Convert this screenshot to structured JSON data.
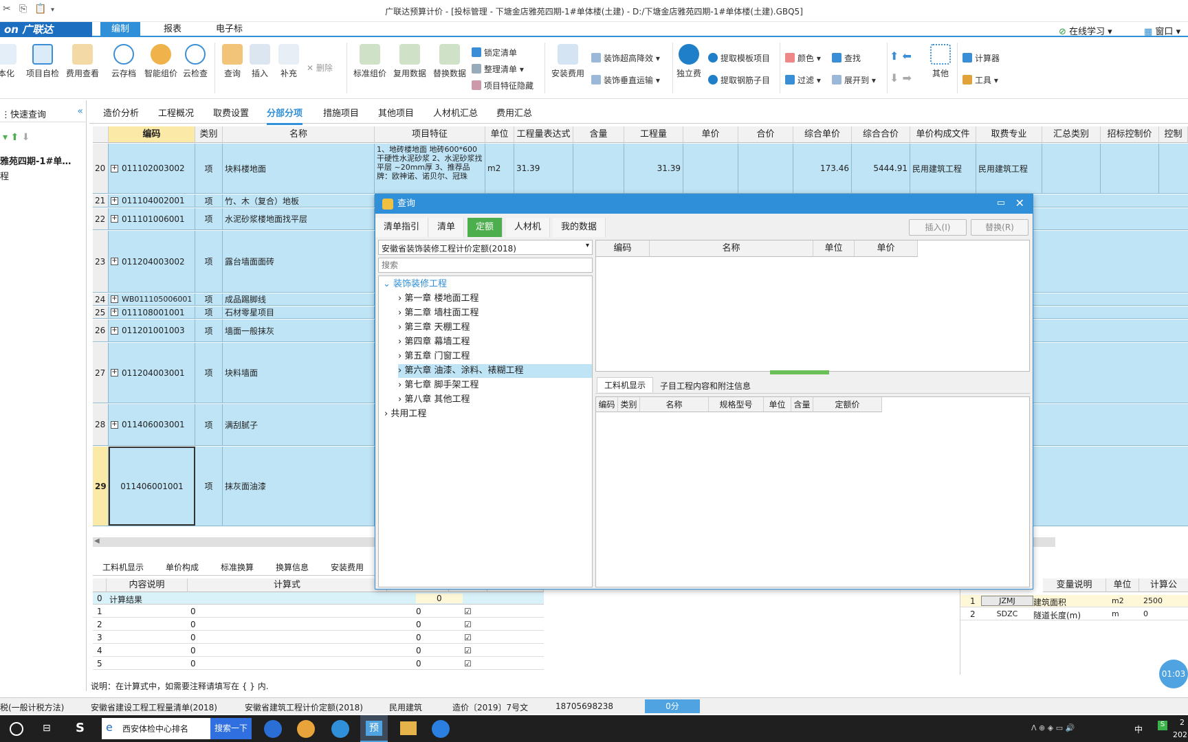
{
  "window_title": "广联达预算计价 - [投标管理 - 下塘金店雅苑四期-1#单体楼(土建) - D:/下塘金店雅苑四期-1#单体楼(土建).GBQ5]",
  "logo": "on 广联达",
  "menu_tabs": [
    "编制",
    "报表",
    "电子标"
  ],
  "menu_right": {
    "learn": "在线学习",
    "window": "窗口"
  },
  "ribbon": {
    "big": [
      "本化",
      "项目自检",
      "费用查看",
      "云存档",
      "智能组价",
      "云检查",
      "查询",
      "插入",
      "补充",
      "标准组价",
      "复用数据",
      "替换数据",
      "安装费用",
      "独立费",
      "其他"
    ],
    "delete": "删除",
    "small": [
      "锁定清单",
      "整理清单",
      "项目特征隐藏",
      "装饰超高降效",
      "装饰垂直运输",
      "提取模板项目",
      "提取钢筋子目",
      "颜色",
      "查找",
      "过滤",
      "展开到",
      "计算器",
      "工具"
    ]
  },
  "left_panel": {
    "quick_query": "快速查询",
    "project": "雅苑四期-1#单…",
    "item": "程"
  },
  "view_tabs": [
    "造价分析",
    "工程概况",
    "取费设置",
    "分部分项",
    "措施项目",
    "其他项目",
    "人材机汇总",
    "费用汇总"
  ],
  "grid": {
    "headers": [
      "编码",
      "类别",
      "名称",
      "项目特征",
      "单位",
      "工程量表达式",
      "含量",
      "工程量",
      "单价",
      "合价",
      "综合单价",
      "综合合价",
      "单价构成文件",
      "取费专业",
      "汇总类别",
      "招标控制价",
      "控制"
    ],
    "rows": [
      {
        "n": "20",
        "code": "011102003002",
        "type": "项",
        "name": "块料楼地面",
        "feature": "1、地砖楼地面 地砖600*600 干硬性水泥砂浆 2、水泥砂浆找平层 ~20mm厚 3、推荐品牌：欧神诺、诺贝尔、冠珠",
        "unit": "m2",
        "expr": "31.39",
        "qty": "31.39",
        "uprice": "173.46",
        "total": "5444.91",
        "file": "民用建筑工程",
        "major": "民用建筑工程"
      },
      {
        "n": "21",
        "code": "011104002001",
        "type": "项",
        "name": "竹、木（复合）地板"
      },
      {
        "n": "22",
        "code": "011101006001",
        "type": "项",
        "name": "水泥砂浆楼地面找平层"
      },
      {
        "n": "23",
        "code": "011204003002",
        "type": "项",
        "name": "露台墙面面砖"
      },
      {
        "n": "24",
        "code": "WB011105006001",
        "type": "项",
        "name": "成品踢脚线"
      },
      {
        "n": "25",
        "code": "011108001001",
        "type": "项",
        "name": "石材零星项目"
      },
      {
        "n": "26",
        "code": "011201001003",
        "type": "项",
        "name": "墙面一般抹灰"
      },
      {
        "n": "27",
        "code": "011204003001",
        "type": "项",
        "name": "块料墙面"
      },
      {
        "n": "28",
        "code": "011406003001",
        "type": "项",
        "name": "满刮腻子"
      },
      {
        "n": "29",
        "code": "011406001001",
        "type": "项",
        "name": "抹灰面油漆"
      }
    ]
  },
  "dialog": {
    "title": "查询",
    "tabs": [
      "清单指引",
      "清单",
      "定额",
      "人材机",
      "我的数据"
    ],
    "insert": "插入(I)",
    "replace": "替换(R)",
    "quota": "安徽省装饰装修工程计价定额(2018)",
    "search_placeholder": "搜索",
    "tree_root": "装饰装修工程",
    "chapters": [
      "第一章 楼地面工程",
      "第二章 墙柱面工程",
      "第三章 天棚工程",
      "第四章 幕墙工程",
      "第五章 门窗工程",
      "第六章 油漆、涂料、裱糊工程",
      "第七章 脚手架工程",
      "第八章 其他工程"
    ],
    "other": "共用工程",
    "right_headers": [
      "编码",
      "名称",
      "单位",
      "单价"
    ],
    "sub_tabs": [
      "工料机显示",
      "子目工程内容和附注信息"
    ],
    "sub_headers": [
      "编码",
      "类别",
      "名称",
      "规格型号",
      "单位",
      "含量",
      "定额价"
    ]
  },
  "bottom": {
    "tabs": [
      "工料机显示",
      "单价构成",
      "标准换算",
      "换算信息",
      "安装费用"
    ],
    "headers": [
      "内容说明",
      "计算式"
    ],
    "rows": [
      {
        "n": "0",
        "desc": "计算结果",
        "val": "0"
      },
      {
        "n": "1",
        "val": "0"
      },
      {
        "n": "2",
        "val": "0"
      },
      {
        "n": "3",
        "val": "0"
      },
      {
        "n": "4",
        "val": "0"
      },
      {
        "n": "5",
        "val": "0"
      }
    ],
    "note": "说明：在计算式中，如需要注释请填写在 { } 内.",
    "var_headers": [
      "变量说明",
      "单位",
      "计算公"
    ],
    "vars": [
      {
        "n": "1",
        "code": "JZMJ",
        "desc": "建筑面积",
        "unit": "m2",
        "val": "2500"
      },
      {
        "n": "2",
        "code": "SDZC",
        "desc": "隧道长度(m)",
        "unit": "m",
        "val": "0"
      }
    ]
  },
  "status": [
    "税(一般计税方法)",
    "安徽省建设工程工程量清单(2018)",
    "安徽省建筑工程计价定额(2018)",
    "民用建筑",
    "造价〔2019〕7号文",
    "18705698238",
    "0分"
  ],
  "timer": "01:03",
  "taskbar": {
    "search_text": "西安体检中心排名",
    "search_btn": "搜索一下",
    "ime": "中",
    "time": "2",
    "date": "202"
  }
}
